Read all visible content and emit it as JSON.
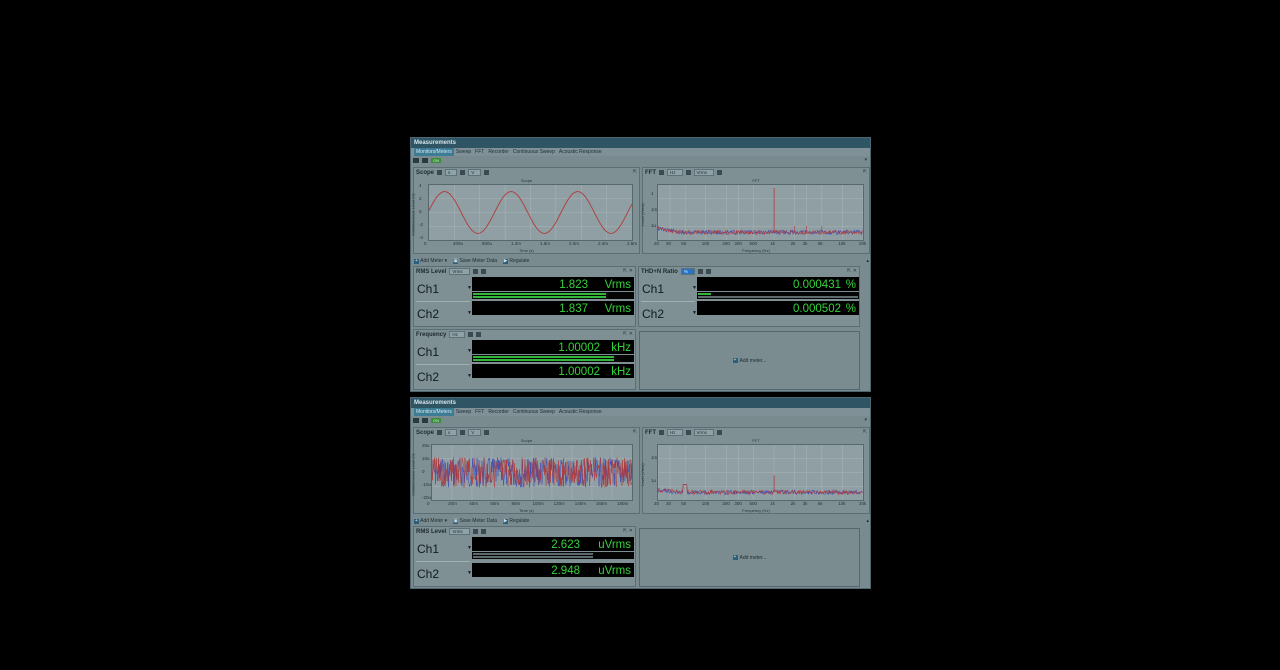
{
  "colors": {
    "green": "#35d23a",
    "scope_trace": "#b23a3a",
    "trace_blue": "#3a4ab8",
    "titlebar": "#2f5564"
  },
  "common": {
    "window_title": "Measurements",
    "tabs": [
      "Monitors/Meters",
      "Sweep",
      "FFT",
      "Recorder",
      "Continuous Sweep",
      "Acoustic Response"
    ],
    "on_label": "ON",
    "meter_toolbar": {
      "add_meter": "Add Meter",
      "save_meter_data": "Save Meter Data",
      "regulate": "Regulate"
    },
    "add_meter_placeholder": "Add meter...",
    "scope_label": "Scope",
    "scope_x_unit": "s",
    "scope_y_unit": "V",
    "scope_title": "Scope",
    "scope_ylabel": "Instantaneous Level (V)",
    "scope_xlabel": "Time (s)",
    "fft_label": "FFT",
    "fft_x_unit": "Hz",
    "fft_y_unit": "Vrms",
    "fft_title": "FFT",
    "fft_ylabel": "Level (Vrms)",
    "fft_xlabel": "Frequency (Hz)",
    "fft_xticks": [
      "20",
      "30",
      "50",
      "100",
      "200",
      "300",
      "500",
      "1k",
      "2k",
      "3k",
      "5k",
      "10k",
      "20k"
    ]
  },
  "panel1": {
    "scope_yticks": [
      "4",
      "2",
      "0",
      "-2",
      "-4"
    ],
    "scope_xticks": [
      "0",
      "400u",
      "800u",
      "1.2m",
      "1.6m",
      "2.0m",
      "2.4m",
      "2.8m"
    ],
    "fft_yticks": [
      "1",
      "1m",
      "1u"
    ],
    "rms": {
      "label": "RMS Level",
      "unit_select": "Vrms",
      "ch1": {
        "name": "Ch1",
        "value": "1.823",
        "unit": "Vrms",
        "bar1": 0.83,
        "bar2": 0.83
      },
      "ch2": {
        "name": "Ch2",
        "value": "1.837",
        "unit": "Vrms",
        "bar1": 0.83,
        "bar2": 0.83
      }
    },
    "thd": {
      "label": "THD+N Ratio",
      "unit_select": "%",
      "ch1": {
        "name": "Ch1",
        "value": "0.000431",
        "unit": "%",
        "bar1": 0.07,
        "bar2": 0.0
      },
      "ch2": {
        "name": "Ch2",
        "value": "0.000502",
        "unit": "%",
        "bar1": 0.08,
        "bar2": 0.0
      }
    },
    "freq": {
      "label": "Frequency",
      "unit_select": "Hz",
      "ch1": {
        "name": "Ch1",
        "value": "1.00002",
        "unit": "kHz",
        "bar1": 0.88,
        "bar2": 0.88
      },
      "ch2": {
        "name": "Ch2",
        "value": "1.00002",
        "unit": "kHz",
        "bar1": 0.88,
        "bar2": 0.88
      }
    }
  },
  "panel2": {
    "scope_yticks": [
      "20u",
      "10u",
      "0",
      "-10u",
      "-20u"
    ],
    "scope_xticks": [
      "0",
      "20m",
      "40m",
      "60m",
      "80m",
      "100m",
      "120m",
      "140m",
      "160m",
      "180m"
    ],
    "fft_yticks": [
      "1m",
      "1u"
    ],
    "rms": {
      "label": "RMS Level",
      "unit_select": "Vrms",
      "ch1": {
        "name": "Ch1",
        "value": "2.623",
        "unit": "uVrms",
        "bar1": 0.0,
        "bar2": 0.0
      },
      "ch2": {
        "name": "Ch2",
        "value": "2.948",
        "unit": "uVrms",
        "bar1": 0.0,
        "bar2": 0.0
      }
    }
  }
}
